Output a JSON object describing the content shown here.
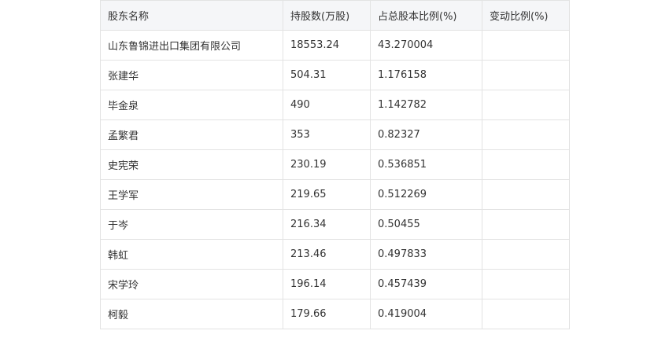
{
  "table": {
    "headers": [
      "股东名称",
      "持股数(万股)",
      "占总股本比例(%)",
      "变动比例(%)"
    ],
    "rows": [
      [
        "山东鲁锦进出口集团有限公司",
        "18553.24",
        "43.270004",
        ""
      ],
      [
        "张建华",
        "504.31",
        "1.176158",
        ""
      ],
      [
        "毕金泉",
        "490",
        "1.142782",
        ""
      ],
      [
        "孟繁君",
        "353",
        "0.82327",
        ""
      ],
      [
        "史宪荣",
        "230.19",
        "0.536851",
        ""
      ],
      [
        "王学军",
        "219.65",
        "0.512269",
        ""
      ],
      [
        "于岑",
        "216.34",
        "0.50455",
        ""
      ],
      [
        "韩虹",
        "213.46",
        "0.497833",
        ""
      ],
      [
        "宋学玲",
        "196.14",
        "0.457439",
        ""
      ],
      [
        "柯毅",
        "179.66",
        "0.419004",
        ""
      ]
    ]
  }
}
